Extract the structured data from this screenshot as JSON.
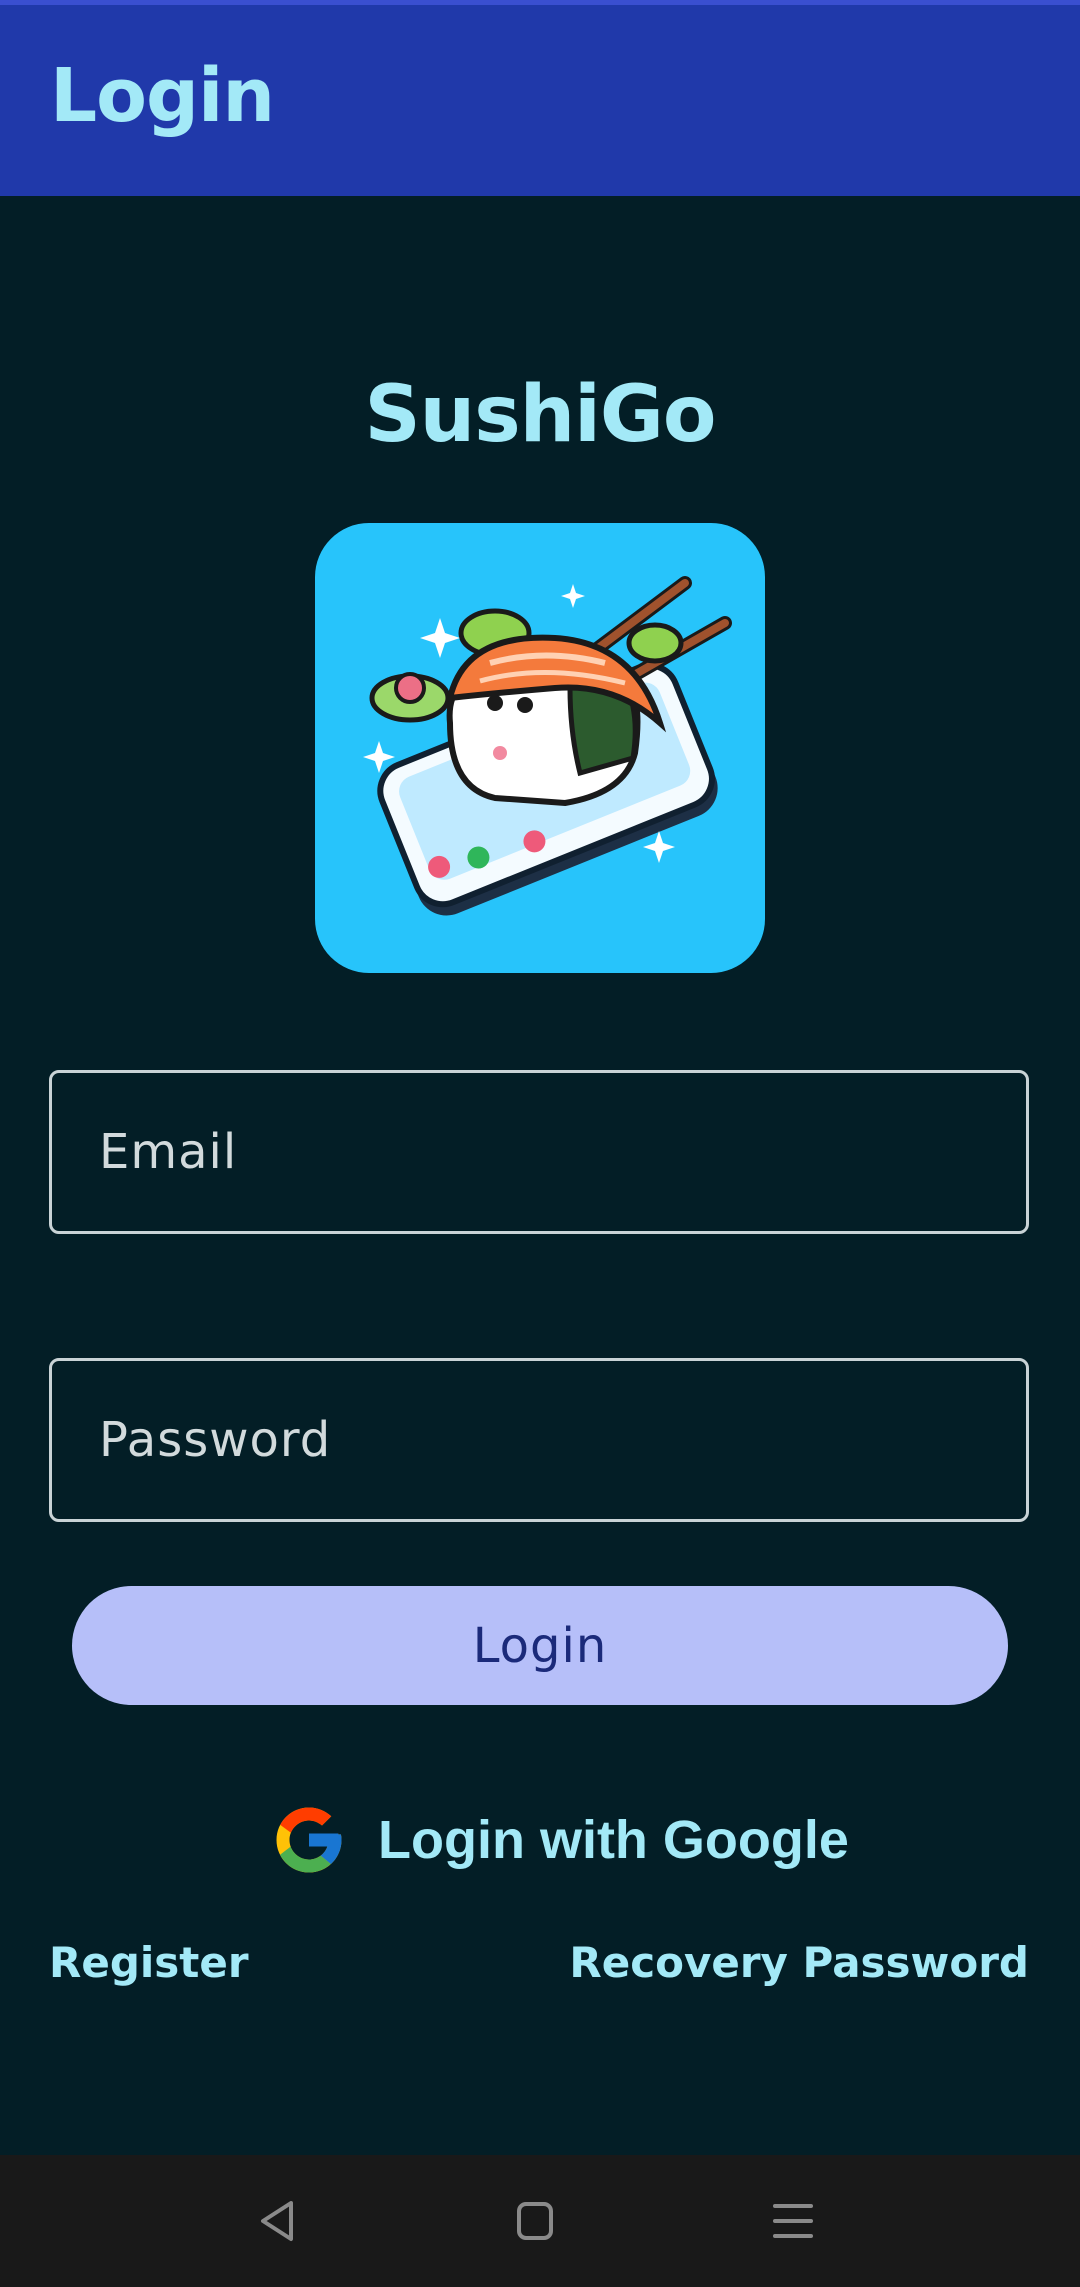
{
  "app_bar": {
    "title": "Login"
  },
  "brand": {
    "title": "SushiGo",
    "logo_icon": "sushi-on-phone-logo",
    "logo_background": "#27c4fb"
  },
  "form": {
    "email_placeholder": "Email",
    "email_value": "",
    "password_placeholder": "Password",
    "password_value": "",
    "login_label": "Login"
  },
  "google": {
    "label": "Login with Google",
    "icon": "google-icon"
  },
  "links": {
    "register": "Register",
    "recovery": "Recovery Password"
  },
  "nav": {
    "back_icon": "back-triangle-icon",
    "home_icon": "home-square-icon",
    "menu_icon": "recents-menu-icon"
  },
  "colors": {
    "background": "#031e26",
    "app_bar": "#2039aa",
    "accent_text": "#a3e9f7",
    "button": "#b6bff9",
    "button_text": "#1b2a7a",
    "nav_bar": "#191919"
  }
}
